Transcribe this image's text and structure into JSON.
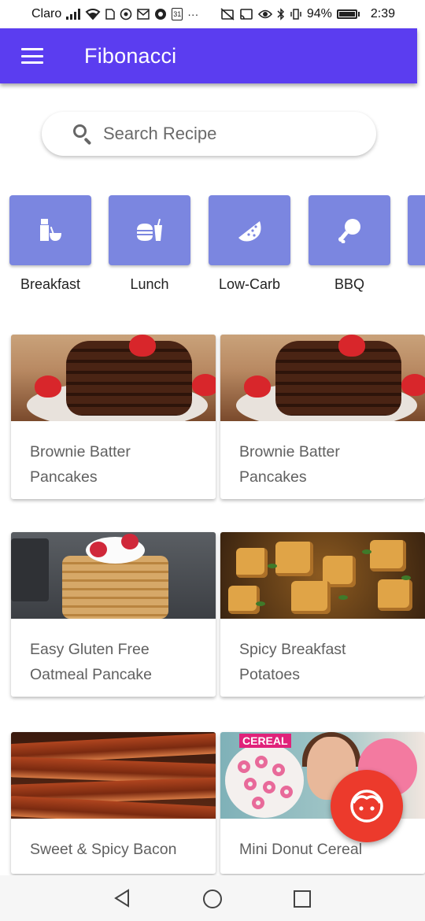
{
  "status_bar": {
    "carrier": "Claro",
    "battery_text": "94%",
    "time": "2:39",
    "left_icons": [
      "signal-icon",
      "wifi-icon",
      "sim-icon",
      "whatsapp-icon",
      "gmail-icon",
      "chrome-icon",
      "calendar-icon",
      "more-icon"
    ],
    "right_icons": [
      "notifications-off-icon",
      "cast-icon",
      "eye-icon",
      "bluetooth-icon",
      "vibrate-icon",
      "battery-icon"
    ],
    "calendar_day": "31",
    "more_text": "···"
  },
  "app_bar": {
    "title": "Fibonacci",
    "background": "#5b3df0"
  },
  "search": {
    "placeholder": "Search Recipe",
    "value": ""
  },
  "categories": [
    {
      "label": "Breakfast",
      "icon": "breakfast-icon"
    },
    {
      "label": "Lunch",
      "icon": "lunch-icon"
    },
    {
      "label": "Low-Carb",
      "icon": "watermelon-icon"
    },
    {
      "label": "BBQ",
      "icon": "drumstick-icon"
    }
  ],
  "category_tile_color": "#7b86e0",
  "recipes": [
    {
      "title": "Brownie Batter Pancakes",
      "image": "brownie-pancakes-image"
    },
    {
      "title": "Brownie Batter Pancakes",
      "image": "brownie-pancakes-image"
    },
    {
      "title": "Easy Gluten Free Oatmeal Pancake",
      "image": "oatmeal-pancake-image"
    },
    {
      "title": "Spicy Breakfast Potatoes",
      "image": "breakfast-potatoes-image"
    },
    {
      "title": "Sweet & Spicy Bacon",
      "image": "bacon-image"
    },
    {
      "title": "Mini Donut Cereal",
      "image": "donut-cereal-image",
      "image_badge": "CEREAL"
    }
  ],
  "fab": {
    "icon": "face-icon",
    "color": "#ec3a2c"
  },
  "nav_bar": {
    "buttons": [
      "back-icon",
      "home-icon",
      "recents-icon"
    ]
  }
}
